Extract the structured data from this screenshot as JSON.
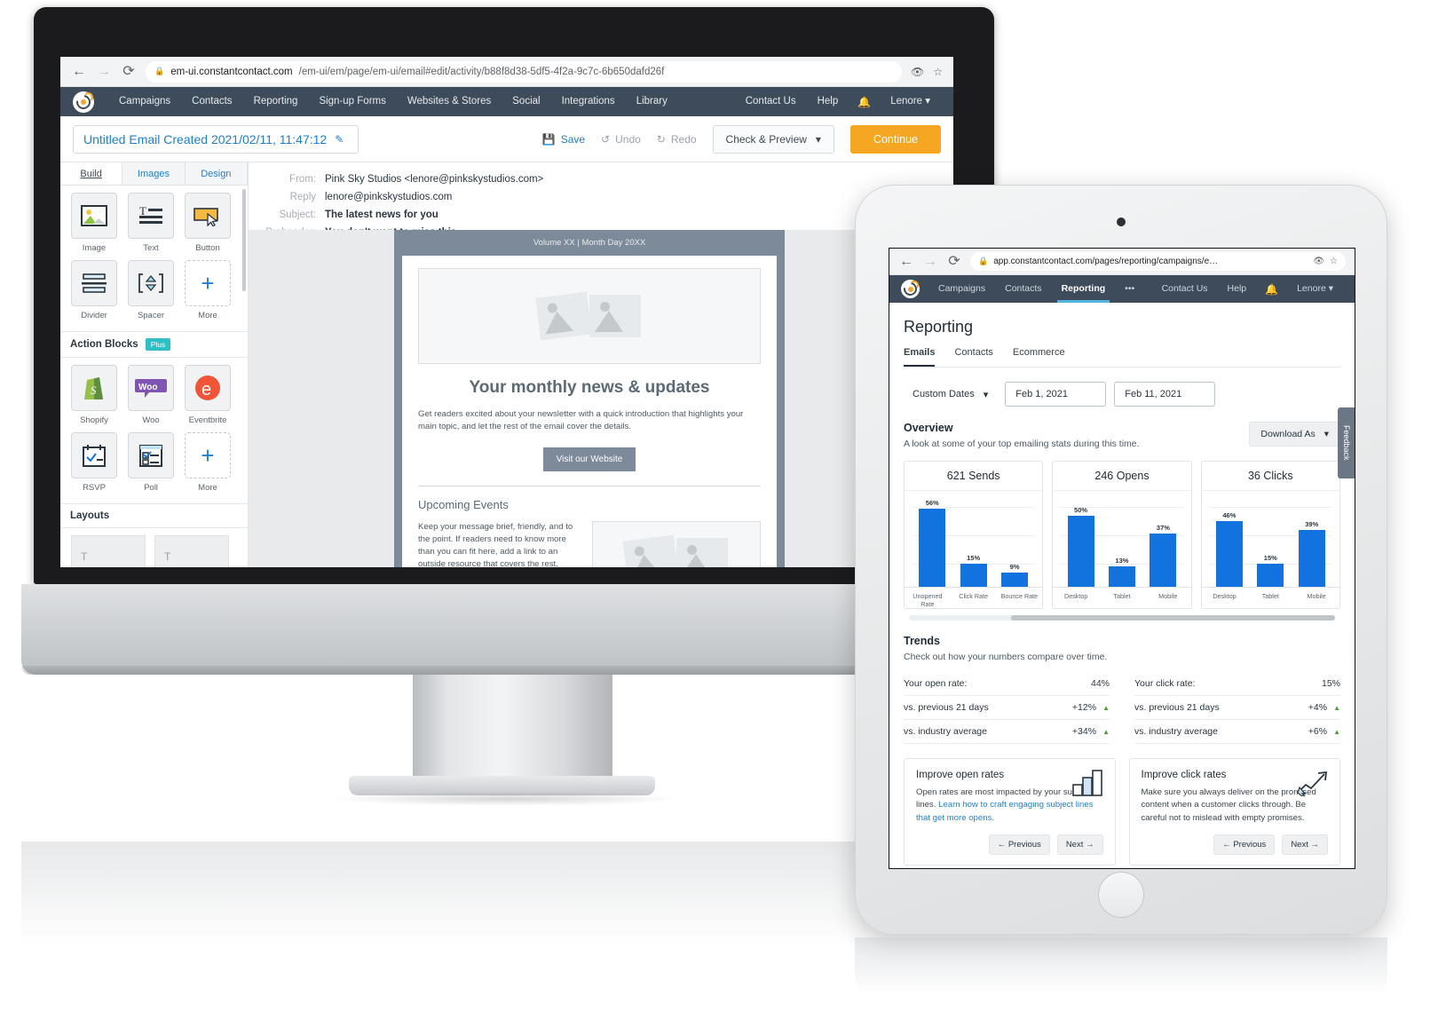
{
  "desktop": {
    "browser": {
      "back_icon": "arrow-left-icon",
      "forward_icon": "arrow-right-icon",
      "reload_icon": "reload-icon",
      "lock_icon": "lock-icon",
      "url_host": "em-ui.constantcontact.com",
      "url_path": "/em-ui/em/page/em-ui/email#edit/activity/b88f8d38-5df5-4f2a-9c7c-6b650dafd26f",
      "eye_icon": "eye-off-icon",
      "star_icon": "star-icon"
    },
    "nav": {
      "logo": "constant-contact-logo",
      "items": [
        "Campaigns",
        "Contacts",
        "Reporting",
        "Sign-up Forms",
        "Websites & Stores",
        "Social",
        "Integrations",
        "Library"
      ],
      "right_items": [
        "Contact Us",
        "Help"
      ],
      "bell_icon": "bell-icon",
      "account": "Lenore",
      "account_caret": "chevron-down-icon"
    },
    "toolbar": {
      "email_title": "Untitled Email Created 2021/02/11, 11:47:12",
      "edit_icon": "pencil-icon",
      "save_label": "Save",
      "save_icon": "save-icon",
      "undo_label": "Undo",
      "undo_icon": "undo-icon",
      "redo_label": "Redo",
      "redo_icon": "redo-icon",
      "check_preview_label": "Check & Preview",
      "check_preview_caret": "chevron-down-icon",
      "continue_label": "Continue"
    },
    "sidebar": {
      "tabs": [
        "Build",
        "Images",
        "Design"
      ],
      "active_tab": "Build",
      "basic_blocks": [
        {
          "label": "Image",
          "icon": "image-block-icon"
        },
        {
          "label": "Text",
          "icon": "text-block-icon"
        },
        {
          "label": "Button",
          "icon": "button-block-icon"
        },
        {
          "label": "Divider",
          "icon": "divider-block-icon"
        },
        {
          "label": "Spacer",
          "icon": "spacer-block-icon"
        },
        {
          "label": "More",
          "icon": "plus-icon"
        }
      ],
      "action_blocks_title": "Action Blocks",
      "action_blocks_badge": "Plus",
      "action_blocks": [
        {
          "label": "Shopify",
          "icon": "shopify-icon"
        },
        {
          "label": "Woo",
          "icon": "woocommerce-icon"
        },
        {
          "label": "Eventbrite",
          "icon": "eventbrite-icon"
        },
        {
          "label": "RSVP",
          "icon": "rsvp-icon"
        },
        {
          "label": "Poll",
          "icon": "poll-icon"
        },
        {
          "label": "More",
          "icon": "plus-icon"
        }
      ],
      "layouts_title": "Layouts"
    },
    "email_meta": [
      {
        "key": "From:",
        "value": "Pink Sky Studios <lenore@pinkskystudios.com>",
        "bold": false
      },
      {
        "key": "Reply",
        "value": "lenore@pinkskystudios.com",
        "bold": false
      },
      {
        "key": "Subject:",
        "value": "The latest news for you",
        "bold": true
      },
      {
        "key": "Preheader:",
        "value": "You don't want to miss this.",
        "bold": true
      }
    ],
    "email_preview": {
      "header": "Volume XX | Month Day 20XX",
      "hero_image_alt": "image-placeholder",
      "headline": "Your monthly news & updates",
      "body": "Get readers excited about your newsletter with a quick introduction that highlights your main topic, and let the rest of the email cover the details.",
      "cta": "Visit our Website",
      "section_title": "Upcoming Events",
      "section_body": "Keep your message brief, friendly, and to the point. If readers need to know more than you can fit here, add a link to an outside resource that covers the rest."
    }
  },
  "tablet": {
    "browser": {
      "back_icon": "arrow-left-icon",
      "forward_icon": "arrow-right-icon",
      "reload_icon": "reload-icon",
      "lock_icon": "lock-icon",
      "url": "app.constantcontact.com/pages/reporting/campaigns/e…",
      "eye_icon": "eye-off-icon",
      "star_icon": "star-icon"
    },
    "nav": {
      "logo": "constant-contact-logo",
      "items": [
        "Campaigns",
        "Contacts",
        "Reporting"
      ],
      "overflow": "•••",
      "active": "Reporting",
      "right_items": [
        "Contact Us",
        "Help"
      ],
      "bell_icon": "bell-icon",
      "account": "Lenore",
      "account_caret": "chevron-down-icon"
    },
    "page_title": "Reporting",
    "tabs": [
      "Emails",
      "Contacts",
      "Ecommerce"
    ],
    "active_tab": "Emails",
    "filters": {
      "range_label": "Custom Dates",
      "range_caret": "chevron-down-icon",
      "start_date": "Feb 1, 2021",
      "end_date": "Feb 11, 2021"
    },
    "overview": {
      "title": "Overview",
      "subtitle": "A look at some of your top emailing stats during this time.",
      "download_label": "Download As",
      "download_caret": "chevron-down-icon"
    },
    "trends": {
      "title": "Trends",
      "subtitle": "Check out how your numbers compare over time.",
      "columns": [
        {
          "rows": [
            {
              "label": "Your open rate:",
              "value": "44%",
              "arrow": ""
            },
            {
              "label": "vs. previous  21 days",
              "value": "+12%",
              "arrow": "▲"
            },
            {
              "label": "vs. industry average",
              "value": "+34%",
              "arrow": "▲"
            }
          ]
        },
        {
          "rows": [
            {
              "label": "Your click rate:",
              "value": "15%",
              "arrow": ""
            },
            {
              "label": "vs. previous  21 days",
              "value": "+4%",
              "arrow": "▲"
            },
            {
              "label": "vs. industry average",
              "value": "+6%",
              "arrow": "▲"
            }
          ]
        }
      ]
    },
    "tips": [
      {
        "title": "Improve open rates",
        "text": "Open rates are most impacted by your subject lines. ",
        "link": "Learn how to craft engaging subject lines that get more opens.",
        "icon": "bar-chart-icon",
        "prev_label": "← Previous",
        "next_label": "Next →"
      },
      {
        "title": "Improve click rates",
        "text": "Make sure you always deliver on the promised content when a customer clicks through. Be careful not to mislead with empty promises.",
        "link": "",
        "icon": "click-chart-icon",
        "prev_label": "← Previous",
        "next_label": "Next →"
      }
    ],
    "feedback_label": "Feedback"
  },
  "chart_data": [
    {
      "type": "bar",
      "title": "621 Sends",
      "categories": [
        "Unopened Rate",
        "Click Rate",
        "Bounce Rate"
      ],
      "values": [
        56,
        15,
        9
      ],
      "value_labels": [
        "56%",
        "15%",
        "9%"
      ],
      "ylabel": "",
      "xlabel": "",
      "ylim": [
        0,
        60
      ],
      "grid": true,
      "series_color": "#1273de"
    },
    {
      "type": "bar",
      "title": "246 Opens",
      "categories": [
        "Desktop",
        "Tablet",
        "Mobile"
      ],
      "values": [
        50,
        13,
        37
      ],
      "value_labels": [
        "50%",
        "13%",
        "37%"
      ],
      "ylabel": "",
      "xlabel": "",
      "ylim": [
        0,
        60
      ],
      "grid": true,
      "series_color": "#1273de"
    },
    {
      "type": "bar",
      "title": "36 Clicks",
      "categories": [
        "Desktop",
        "Tablet",
        "Mobile"
      ],
      "values": [
        46,
        15,
        39
      ],
      "value_labels": [
        "46%",
        "15%",
        "39%"
      ],
      "ylabel": "",
      "xlabel": "",
      "ylim": [
        0,
        60
      ],
      "grid": true,
      "series_color": "#1273de"
    }
  ]
}
